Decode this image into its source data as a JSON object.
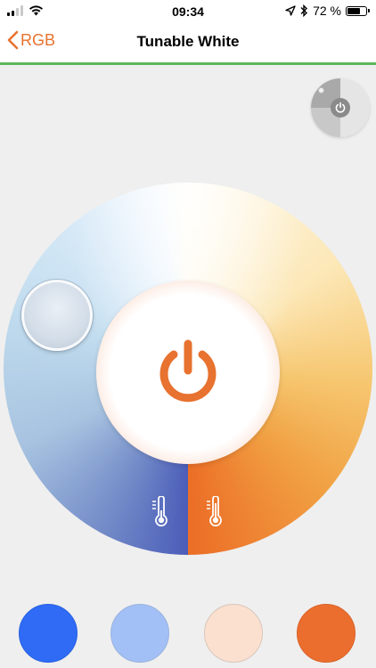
{
  "status_bar": {
    "time": "09:34",
    "battery": "72 %",
    "battery_level": 0.72,
    "icons": [
      "cellular-signal-icon",
      "wifi-icon",
      "location-arrow-icon",
      "bluetooth-icon",
      "battery-icon"
    ]
  },
  "nav": {
    "back_label": "RGB",
    "title": "Tunable White"
  },
  "colors": {
    "accent": "#e8722f",
    "divider": "#5cb85c",
    "cool_end": "#4b5db9",
    "warm_end": "#ec6f27",
    "presets": [
      "#2f6bf5",
      "#a2c0f6",
      "#fbe0d0",
      "#ec6e2e"
    ]
  },
  "controls": {
    "corner_toggle_icon": "power-icon",
    "center_button_icon": "power-icon",
    "cool_icon": "thermometer-low-icon",
    "warm_icon": "thermometer-high-icon"
  }
}
